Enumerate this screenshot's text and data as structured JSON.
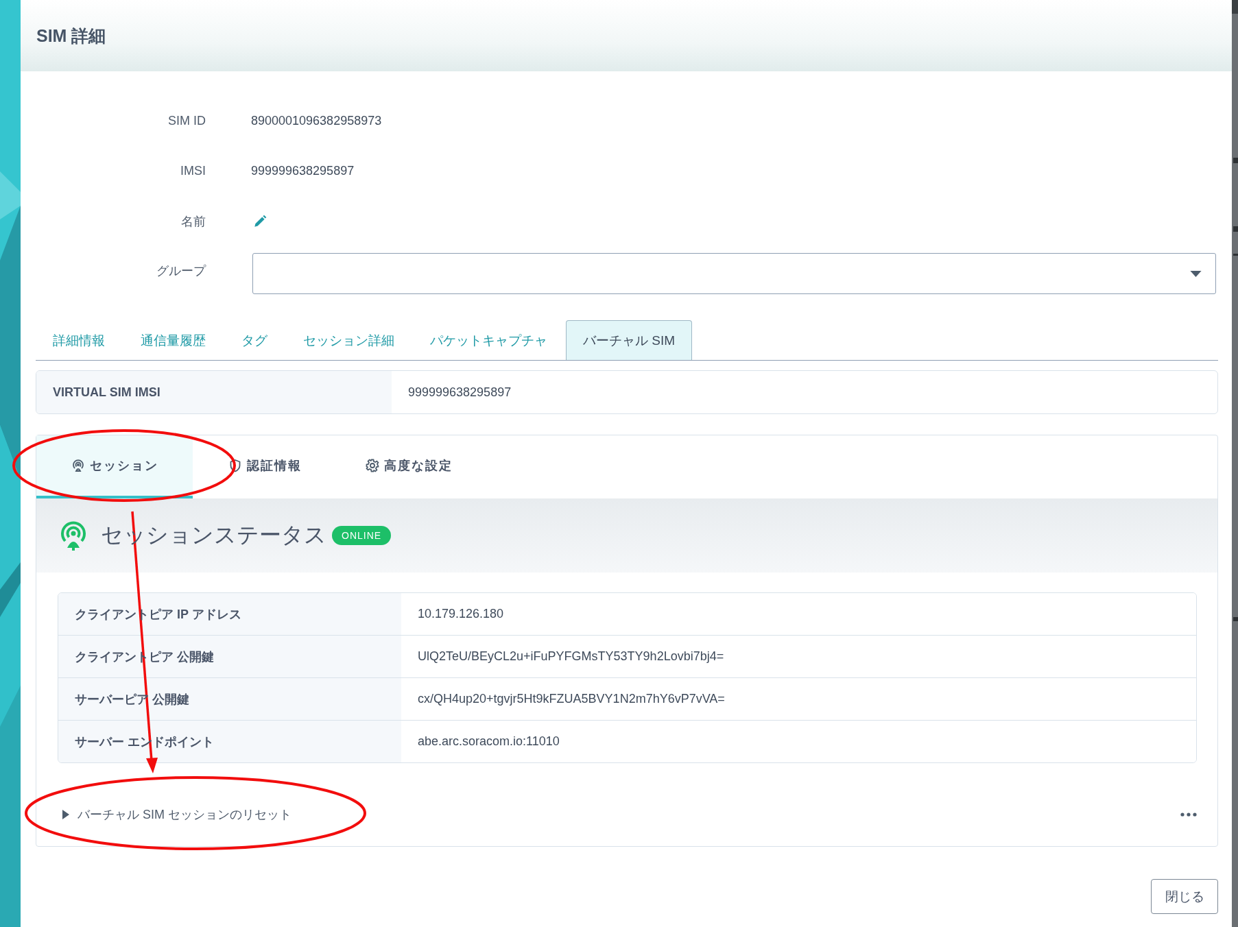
{
  "dialog": {
    "title": "SIM 詳細"
  },
  "fields": [
    {
      "kind": "text",
      "label": "SIM ID",
      "value": "8900001096382958973"
    },
    {
      "kind": "text",
      "label": "IMSI",
      "value": "999999638295897"
    },
    {
      "kind": "edit",
      "label": "名前"
    },
    {
      "kind": "select",
      "label": "グループ"
    }
  ],
  "tabs": [
    {
      "label": "詳細情報",
      "selected": false
    },
    {
      "label": "通信量履歴",
      "selected": false
    },
    {
      "label": "タグ",
      "selected": false
    },
    {
      "label": "セッション詳細",
      "selected": false
    },
    {
      "label": "パケットキャプチャ",
      "selected": false
    },
    {
      "label": "バーチャル SIM",
      "selected": true
    }
  ],
  "virtual_sim": {
    "label": "VIRTUAL SIM IMSI",
    "value": "999999638295897"
  },
  "sub_tabs": [
    {
      "label": "セッション",
      "selected": true
    },
    {
      "label": "認証情報",
      "selected": false
    },
    {
      "label": "高度な設定",
      "selected": false
    }
  ],
  "session_status": {
    "title": "セッションステータス",
    "status": "ONLINE"
  },
  "session_rows": [
    {
      "label": "クライアントピア IP アドレス",
      "value": "10.179.126.180"
    },
    {
      "label": "クライアントピア 公開鍵",
      "value": "UlQ2TeU/BEyCL2u+iFuPYFGMsTY53TY9h2Lovbi7bj4="
    },
    {
      "label": "サーバーピア 公開鍵",
      "value": "cx/QH4up20+tgvjr5Ht9kFZUA5BVY1N2m7hY6vP7vVA="
    },
    {
      "label": "サーバー エンドポイント",
      "value": "abe.arc.soracom.io:11010"
    }
  ],
  "reset": {
    "label": "バーチャル SIM セッションのリセット",
    "expanded": false
  },
  "buttons": [
    {
      "label": "閉じる"
    }
  ]
}
